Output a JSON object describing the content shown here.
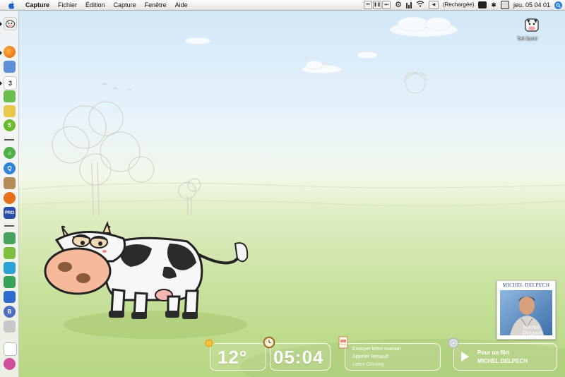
{
  "menubar": {
    "app_name": "Capture",
    "menus": [
      "Fichier",
      "Édition",
      "Capture",
      "Fenêtre",
      "Aide"
    ],
    "battery_status": "(Rechargée)",
    "clock": "jeu. 05 04 01"
  },
  "desktop_icon": {
    "label": "Teh farm!"
  },
  "weather_widget": {
    "temperature": "12°"
  },
  "clock_widget": {
    "time": "05:04"
  },
  "todo_widget": {
    "items": [
      "Envoyer lettre maman",
      "Appeler Renaud",
      "Lettre Chuong"
    ]
  },
  "itunes_widget": {
    "track": "Pour un flirt",
    "artist": "MICHEL DELPECH"
  },
  "album_art": {
    "title": "MICHEL DELPECH",
    "signature": "Michel Delpech"
  },
  "dock": {
    "icons": [
      "cow-app-icon",
      "firefox-icon",
      "preview-icon",
      "ical-icon",
      "ichat-icon",
      "adium-icon",
      "skype-icon",
      "itunes-icon",
      "quicktime-icon",
      "chess-icon",
      "podcast-icon",
      "pro-app-icon",
      "cash-icon",
      "pencil-app-icon",
      "network-icon",
      "stuffit-icon",
      "brochure-icon",
      "document-icon",
      "monster-icon"
    ]
  }
}
